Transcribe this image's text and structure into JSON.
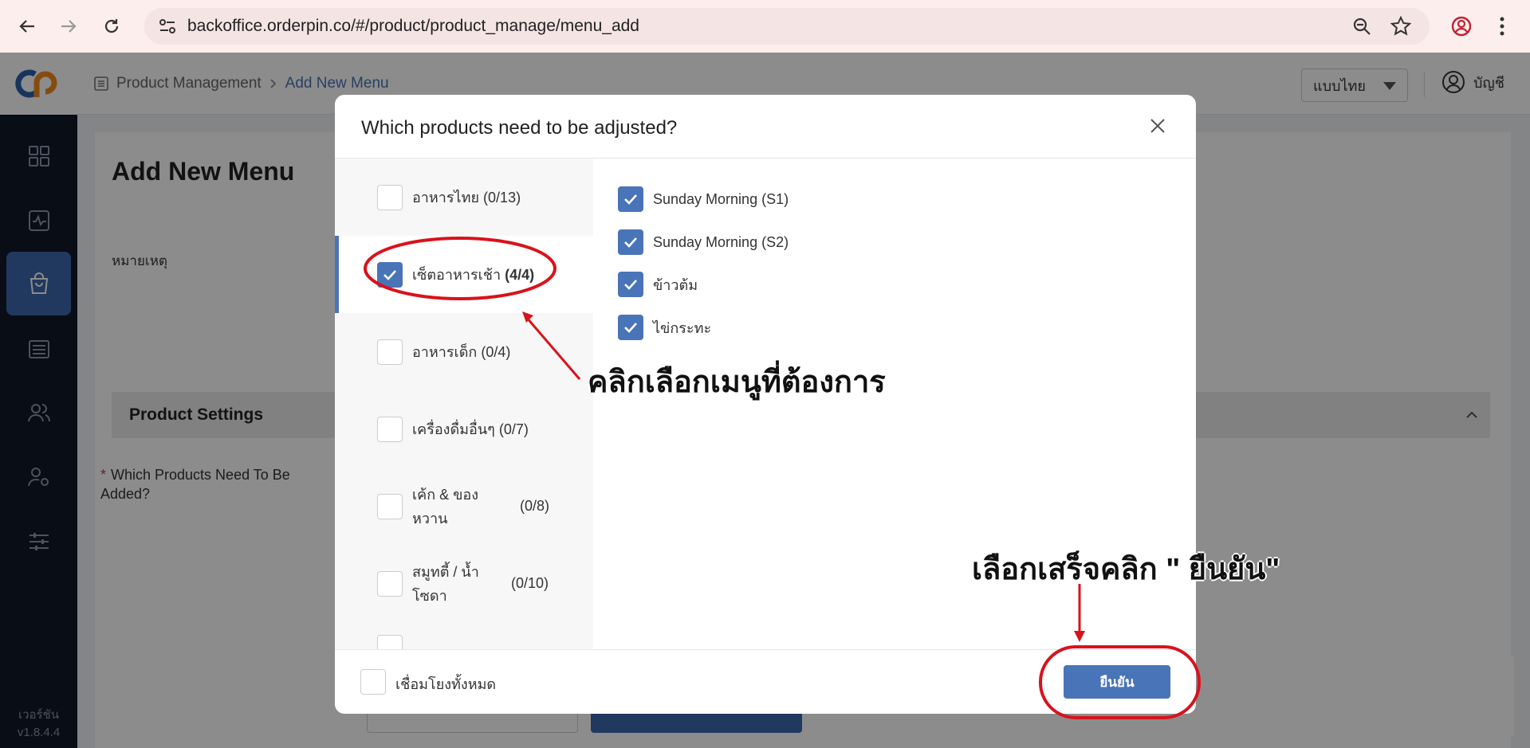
{
  "browser": {
    "url": "backoffice.orderpin.co/#/product/product_manage/menu_add"
  },
  "header": {
    "breadcrumb": [
      "Product Management",
      "Add New Menu"
    ],
    "language": "แบบไทย",
    "account_label": "บัญชี"
  },
  "sidebar": {
    "icons": [
      "grid-icon",
      "chart-icon",
      "bag-icon",
      "register-icon",
      "users-icon",
      "user-settings-icon",
      "sliders-icon"
    ],
    "active_index": 2,
    "version_label": "เวอร์ชัน",
    "version": "v1.8.4.4"
  },
  "page": {
    "title": "Add New Menu",
    "note_label": "หมายเหตุ",
    "settings_title": "Product Settings",
    "required_label": "Which Products Need To Be Added?"
  },
  "modal": {
    "title": "Which products need to be adjusted?",
    "categories": [
      {
        "label": "อาหารไทย",
        "count": "(0/13)",
        "checked": false,
        "active": false
      },
      {
        "label": "เซ็ตอาหารเช้า",
        "count": "(4/4)",
        "checked": true,
        "active": true
      },
      {
        "label": "อาหารเด็ก",
        "count": "(0/4)",
        "checked": false,
        "active": false
      },
      {
        "label": "เครื่องดื่มอื่นๆ",
        "count": "(0/7)",
        "checked": false,
        "active": false
      },
      {
        "label": "เค้ก & ของหวาน",
        "count": "(0/8)",
        "checked": false,
        "active": false
      },
      {
        "label": "สมูทตี้ / น้ำโซดา",
        "count": "(0/10)",
        "checked": false,
        "active": false
      }
    ],
    "products": [
      {
        "label": "Sunday Morning (S1)",
        "checked": true
      },
      {
        "label": "Sunday Morning (S2)",
        "checked": true
      },
      {
        "label": "ข้าวต้ม",
        "checked": true
      },
      {
        "label": "ไข่กระทะ",
        "checked": true
      }
    ],
    "link_all_label": "เชื่อมโยงทั้งหมด",
    "confirm_label": "ยืนยัน"
  },
  "annotations": {
    "select_menu": "คลิกเลือกเมนูที่ต้องการ",
    "click_confirm": "เลือกเสร็จคลิก \" ยืนยัน\"",
    "color": "#d8131b"
  }
}
